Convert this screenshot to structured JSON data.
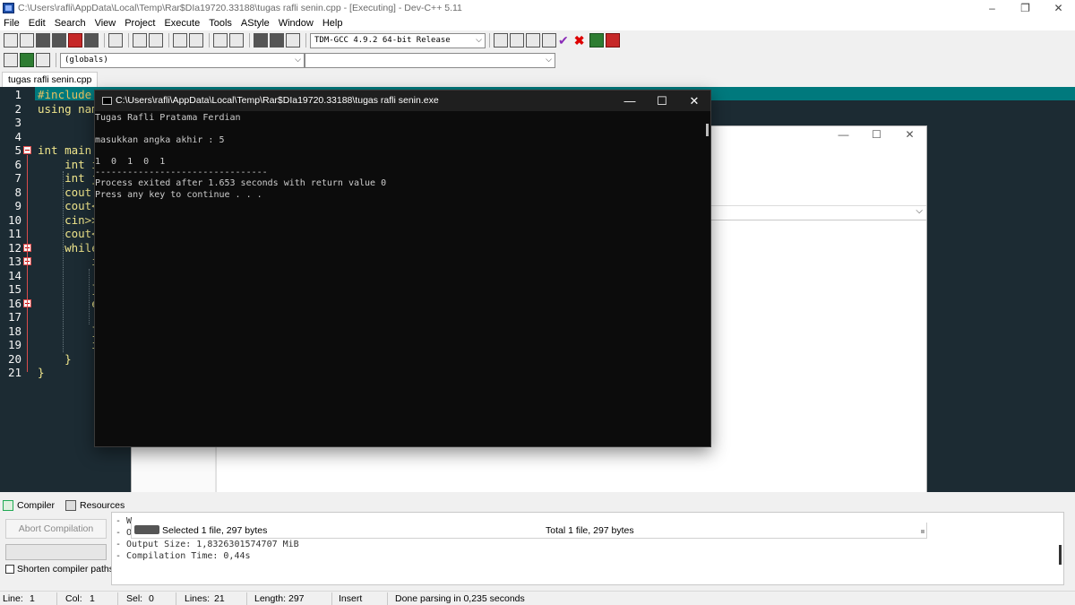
{
  "window": {
    "title": "C:\\Users\\rafli\\AppData\\Local\\Temp\\Rar$DIa19720.33188\\tugas rafli senin.cpp - [Executing] - Dev-C++ 5.11",
    "min": "–",
    "max": "❐",
    "close": "✕"
  },
  "menu": [
    "File",
    "Edit",
    "Search",
    "View",
    "Project",
    "Execute",
    "Tools",
    "AStyle",
    "Window",
    "Help"
  ],
  "toolbar": {
    "compiler": "TDM-GCC 4.9.2 64-bit Release",
    "scope": "(globals)"
  },
  "file_tab": "tugas rafli senin.cpp",
  "editor": {
    "line_numbers": [
      "1",
      "2",
      "3",
      "4",
      "5",
      "6",
      "7",
      "8",
      "9",
      "10",
      "11",
      "12",
      "13",
      "14",
      "15",
      "16",
      "17",
      "18",
      "19",
      "20",
      "21"
    ],
    "lines": [
      "#include",
      "using nam",
      "",
      "",
      "int main",
      "    int i",
      "    int j",
      "    cout",
      "    cout<",
      "    cin>>",
      "    cout<",
      "    while",
      "        i",
      "",
      "        }",
      "        e",
      "",
      "        }",
      "        i",
      "    }",
      "}"
    ]
  },
  "console": {
    "title": "C:\\Users\\rafli\\AppData\\Local\\Temp\\Rar$DIa19720.33188\\tugas rafli senin.exe",
    "lines": [
      "Tugas Rafli Pratama Ferdian",
      "",
      "masukkan angka akhir : 5",
      "",
      "1  0  1  0  1",
      "--------------------------------",
      "Process exited after 1.653 seconds with return value 0",
      "Press any key to continue . . ."
    ],
    "min": "—",
    "max": "☐",
    "close": "✕"
  },
  "dialog": {
    "status_left": "Selected 1 file, 297 bytes",
    "status_right": "Total 1 file, 297 bytes",
    "min": "—",
    "max": "☐",
    "close": "✕"
  },
  "bottom": {
    "tabs": [
      "Compiler",
      "Resources"
    ],
    "abort_label": "Abort Compilation",
    "shorten_label": "Shorten compiler paths",
    "log_lines": [
      "- W",
      "- O",
      "- Output Size: 1,8326301574707 MiB",
      "- Compilation Time: 0,44s"
    ]
  },
  "statusbar": {
    "line_label": "Line:",
    "line_value": "1",
    "col_label": "Col:",
    "col_value": "1",
    "sel_label": "Sel:",
    "sel_value": "0",
    "lines_label": "Lines:",
    "lines_value": "21",
    "length_label": "Length:",
    "length_value": "297",
    "mode": "Insert",
    "message": "Done parsing in 0,235 seconds"
  }
}
